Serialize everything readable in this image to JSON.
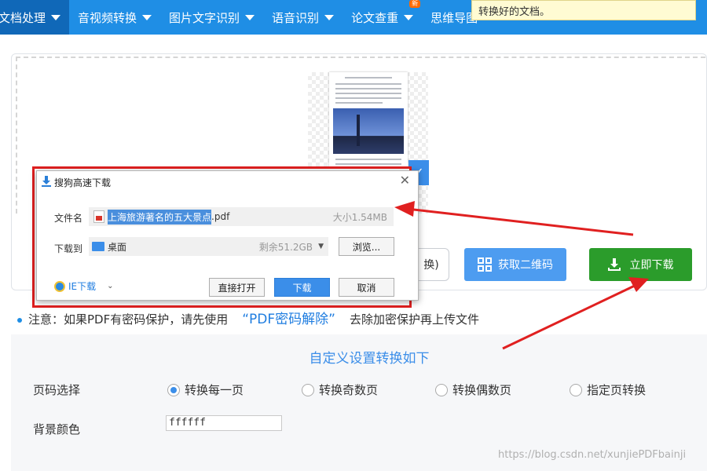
{
  "nav": {
    "items": [
      {
        "label": "文档处理",
        "active": true
      },
      {
        "label": "音视频转换"
      },
      {
        "label": "图片文字识别"
      },
      {
        "label": "语音识别"
      },
      {
        "label": "论文查重",
        "badge": "新"
      },
      {
        "label": "思维导图"
      }
    ]
  },
  "tooltip": {
    "text": "转换好的文档。"
  },
  "actions": {
    "prev_label": "换)",
    "qr_label": "获取二维码",
    "download_label": "立即下载"
  },
  "note": {
    "prefix": "注意：如果PDF有密码保护，请先使用",
    "link": "“PDF密码解除”",
    "suffix": "去除加密保护再上传文件"
  },
  "settings": {
    "title": "自定义设置转换如下",
    "page_label": "页码选择",
    "options": [
      {
        "label": "转换每一页",
        "checked": true
      },
      {
        "label": "转换奇数页",
        "checked": false
      },
      {
        "label": "转换偶数页",
        "checked": false
      },
      {
        "label": "指定页转换",
        "checked": false
      }
    ],
    "bg_label": "背景颜色",
    "bg_value": "ffffff"
  },
  "dialog": {
    "title": "搜狗高速下载",
    "filename_label": "文件名",
    "filename_highlight": "上海旅游著名的五大景点",
    "filename_ext": ".pdf",
    "size": "大小1.54MB",
    "saveto_label": "下载到",
    "folder": "桌面",
    "free_space": "剩余51.2GB",
    "browse": "浏览...",
    "ie_download": "IE下载",
    "open_direct": "直接打开",
    "download": "下载",
    "cancel": "取消"
  },
  "watermark": "https://blog.csdn.net/xunjiePDFbainji",
  "colors": {
    "nav": "#1f8ee5",
    "primary": "#3b8ee9",
    "download": "#2b9c2b",
    "highlight": "#e02020"
  }
}
